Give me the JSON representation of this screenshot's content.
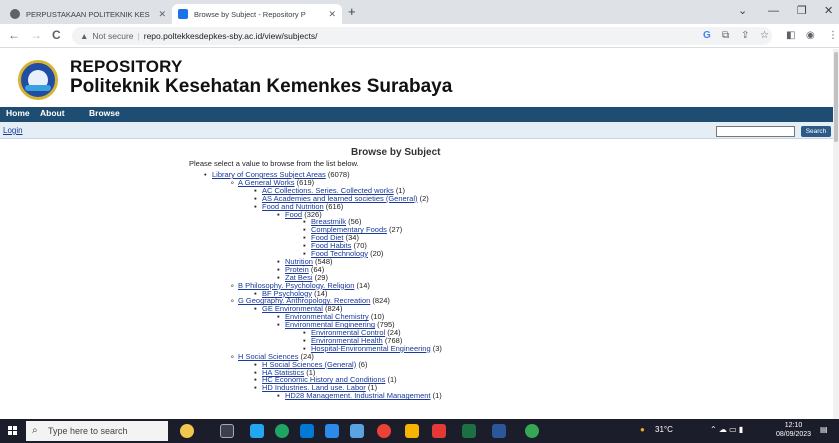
{
  "browser": {
    "tabs": [
      {
        "title": "PERPUSTAKAAN POLITEKNIK KES",
        "active": false
      },
      {
        "title": "Browse by Subject - Repository P",
        "active": true
      }
    ],
    "new_tab": "+",
    "address": {
      "security": "Not secure",
      "url": "repo.poltekkesdepkes-sby.ac.id/view/subjects/"
    },
    "nav": {
      "back": "←",
      "forward": "→",
      "reload": "C"
    },
    "window_controls": {
      "chevron": "⌄",
      "minimize": "—",
      "maximize": "❐",
      "close": "✕"
    },
    "toolbar_icons": [
      "G",
      "⧉",
      "⇪",
      "☆",
      "◧",
      "◉",
      "⋮"
    ]
  },
  "site": {
    "title_line1": "REPOSITORY",
    "title_line2": "Politeknik Kesehatan Kemenkes Surabaya",
    "menu": {
      "home": "Home",
      "about": "About",
      "browse": "Browse"
    },
    "login": "Login",
    "search_button": "Search",
    "search_value": ""
  },
  "content": {
    "title": "Browse by Subject",
    "intro": "Please select a value to browse from the list below.",
    "tree": [
      {
        "label": "Library of Congress Subject Areas",
        "count": "(6078)",
        "level": 0
      },
      {
        "label": "A General Works",
        "count": "(619)",
        "level": 1
      },
      {
        "label": "AC Collections. Series. Collected works",
        "count": "(1)",
        "level": 2
      },
      {
        "label": "AS Academies and learned societies (General)",
        "count": "(2)",
        "level": 2
      },
      {
        "label": "Food and Nutrition",
        "count": "(616)",
        "level": 2
      },
      {
        "label": "Food",
        "count": "(326)",
        "level": 3
      },
      {
        "label": "Breastmilk",
        "count": "(56)",
        "level": 4
      },
      {
        "label": "Complementary Foods",
        "count": "(27)",
        "level": 4
      },
      {
        "label": "Food Diet",
        "count": "(34)",
        "level": 4
      },
      {
        "label": "Food Habits",
        "count": "(70)",
        "level": 4
      },
      {
        "label": "Food Technology",
        "count": "(20)",
        "level": 4
      },
      {
        "label": "Nutrition",
        "count": "(548)",
        "level": 3
      },
      {
        "label": "Protein",
        "count": "(64)",
        "level": 3
      },
      {
        "label": "Zat Besi",
        "count": "(29)",
        "level": 3
      },
      {
        "label": "B Philosophy. Psychology. Religion",
        "count": "(14)",
        "level": 1
      },
      {
        "label": "BF Psychology",
        "count": "(14)",
        "level": 2
      },
      {
        "label": "G Geography. Anthropology. Recreation",
        "count": "(824)",
        "level": 1
      },
      {
        "label": "GE Environmental",
        "count": "(824)",
        "level": 2
      },
      {
        "label": "Environmental Chemistry",
        "count": "(10)",
        "level": 3
      },
      {
        "label": "Environmental Engineering",
        "count": "(795)",
        "level": 3
      },
      {
        "label": "Environmental Control",
        "count": "(24)",
        "level": 4
      },
      {
        "label": "Environmental Health",
        "count": "(768)",
        "level": 4
      },
      {
        "label": "Hospital-Environmental Engineering",
        "count": "(3)",
        "level": 4
      },
      {
        "label": "H Social Sciences",
        "count": "(24)",
        "level": 1
      },
      {
        "label": "H Social Sciences (General)",
        "count": "(6)",
        "level": 2
      },
      {
        "label": "HA Statistics",
        "count": "(1)",
        "level": 2
      },
      {
        "label": "HC Economic History and Conditions",
        "count": "(1)",
        "level": 2
      },
      {
        "label": "HD Industries. Land use. Labor",
        "count": "(1)",
        "level": 2
      },
      {
        "label": "HD28 Management. Industrial Management",
        "count": "(1)",
        "level": 3
      }
    ]
  },
  "taskbar": {
    "search_placeholder": "Type here to search",
    "weather": "31°C",
    "time": "12:10",
    "date": "08/09/2023"
  }
}
